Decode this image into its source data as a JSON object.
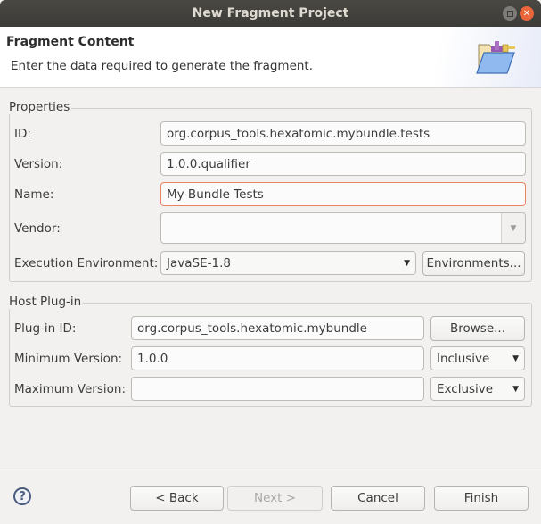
{
  "window": {
    "title": "New Fragment Project",
    "maximize_icon": "maximize-icon",
    "close_icon": "close-icon"
  },
  "header": {
    "title": "Fragment Content",
    "description": "Enter the data required to generate the fragment.",
    "icon": "folder-plugin-icon"
  },
  "properties": {
    "group_label": "Properties",
    "id_label": "ID:",
    "id_value": "org.corpus_tools.hexatomic.mybundle.tests",
    "version_label": "Version:",
    "version_value": "1.0.0.qualifier",
    "name_label": "Name:",
    "name_value": "My Bundle Tests",
    "vendor_label": "Vendor:",
    "vendor_value": "",
    "exec_env_label": "Execution Environment:",
    "exec_env_value": "JavaSE-1.8",
    "environments_button": "Environments..."
  },
  "host_plugin": {
    "group_label": "Host Plug-in",
    "plugin_id_label": "Plug-in ID:",
    "plugin_id_value": "org.corpus_tools.hexatomic.mybundle",
    "browse_button": "Browse...",
    "min_version_label": "Minimum Version:",
    "min_version_value": "1.0.0",
    "min_version_mode": "Inclusive",
    "max_version_label": "Maximum Version:",
    "max_version_value": "",
    "max_version_mode": "Exclusive"
  },
  "footer": {
    "help_icon": "help-icon",
    "back_button": "< Back",
    "next_button": "Next >",
    "cancel_button": "Cancel",
    "finish_button": "Finish"
  }
}
